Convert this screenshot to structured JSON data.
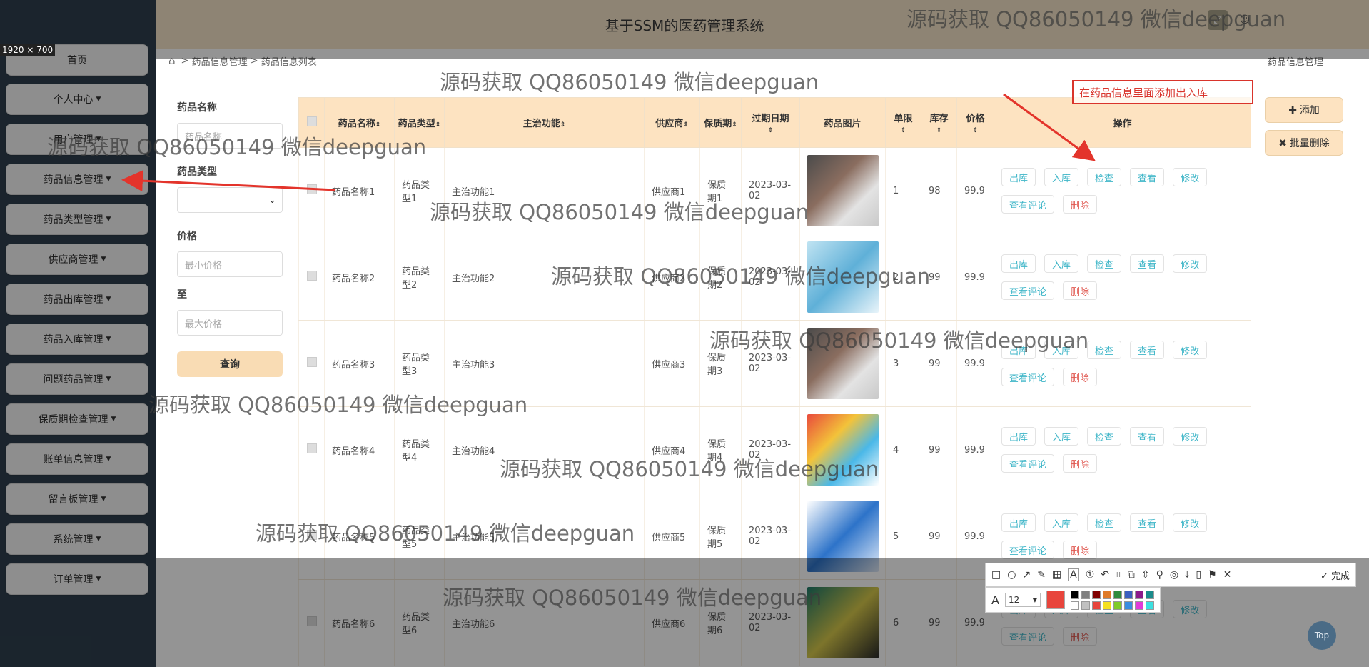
{
  "header": {
    "title": "基于SSM的医药管理系统"
  },
  "size_badge": "1920 × 700",
  "sidebar": {
    "items": [
      {
        "label": "首页",
        "caret": false
      },
      {
        "label": "个人中心",
        "caret": true
      },
      {
        "label": "用户管理",
        "caret": true
      },
      {
        "label": "药品信息管理",
        "caret": true
      },
      {
        "label": "药品类型管理",
        "caret": true
      },
      {
        "label": "供应商管理",
        "caret": true
      },
      {
        "label": "药品出库管理",
        "caret": true
      },
      {
        "label": "药品入库管理",
        "caret": true
      },
      {
        "label": "问题药品管理",
        "caret": true
      },
      {
        "label": "保质期检查管理",
        "caret": true
      },
      {
        "label": "账单信息管理",
        "caret": true
      },
      {
        "label": "留言板管理",
        "caret": true
      },
      {
        "label": "系统管理",
        "caret": true
      },
      {
        "label": "订单管理",
        "caret": true
      }
    ]
  },
  "breadcrumb": {
    "sep": ">",
    "level1": "药品信息管理",
    "level2": "药品信息列表",
    "right": "药品信息管理"
  },
  "search": {
    "name_label": "药品名称",
    "name_placeholder": "药品名称",
    "type_label": "药品类型",
    "price_label": "价格",
    "min_placeholder": "最小价格",
    "to_label": "至",
    "max_placeholder": "最大价格",
    "query_button": "查询"
  },
  "actions": {
    "add": "添加",
    "batch_delete": "批量删除"
  },
  "annotation": {
    "text": "在药品信息里面添加出入库"
  },
  "table": {
    "headers": [
      "药品名称",
      "药品类型",
      "主治功能",
      "供应商",
      "保质期",
      "过期日期",
      "药品图片",
      "单限",
      "库存",
      "价格",
      "操作"
    ],
    "rows": [
      {
        "name": "药品名称1",
        "type": "药品类型1",
        "func": "主治功能1",
        "supplier": "供应商1",
        "shelf": "保质期1",
        "expire": "2023-03-02",
        "limit": "1",
        "stock": "98",
        "price": "99.9"
      },
      {
        "name": "药品名称2",
        "type": "药品类型2",
        "func": "主治功能2",
        "supplier": "供应商2",
        "shelf": "保质期2",
        "expire": "2023-03-02",
        "limit": "2",
        "stock": "99",
        "price": "99.9"
      },
      {
        "name": "药品名称3",
        "type": "药品类型3",
        "func": "主治功能3",
        "supplier": "供应商3",
        "shelf": "保质期3",
        "expire": "2023-03-02",
        "limit": "3",
        "stock": "99",
        "price": "99.9"
      },
      {
        "name": "药品名称4",
        "type": "药品类型4",
        "func": "主治功能4",
        "supplier": "供应商4",
        "shelf": "保质期4",
        "expire": "2023-03-02",
        "limit": "4",
        "stock": "99",
        "price": "99.9"
      },
      {
        "name": "药品名称5",
        "type": "药品类型5",
        "func": "主治功能5",
        "supplier": "供应商5",
        "shelf": "保质期5",
        "expire": "2023-03-02",
        "limit": "5",
        "stock": "99",
        "price": "99.9"
      },
      {
        "name": "药品名称6",
        "type": "药品类型6",
        "func": "主治功能6",
        "supplier": "供应商6",
        "shelf": "保质期6",
        "expire": "2023-03-02",
        "limit": "6",
        "stock": "99",
        "price": "99.9"
      }
    ],
    "ops": [
      "出库",
      "入库",
      "检查",
      "查看",
      "修改",
      "查看评论",
      "删除"
    ]
  },
  "snip_toolbar": {
    "done": "完成",
    "font_size": "12"
  },
  "top_button": "Top",
  "watermark": "源码获取 QQ86050149 微信deepguan",
  "colors": {
    "header_bg": "#f4e3c8",
    "sidebar_bg": "#2f3f4e",
    "table_header_bg": "#fde3c1",
    "op_text": "#3fb6c8",
    "delete_text": "#e0574f",
    "annotation_red": "#d9342b"
  }
}
